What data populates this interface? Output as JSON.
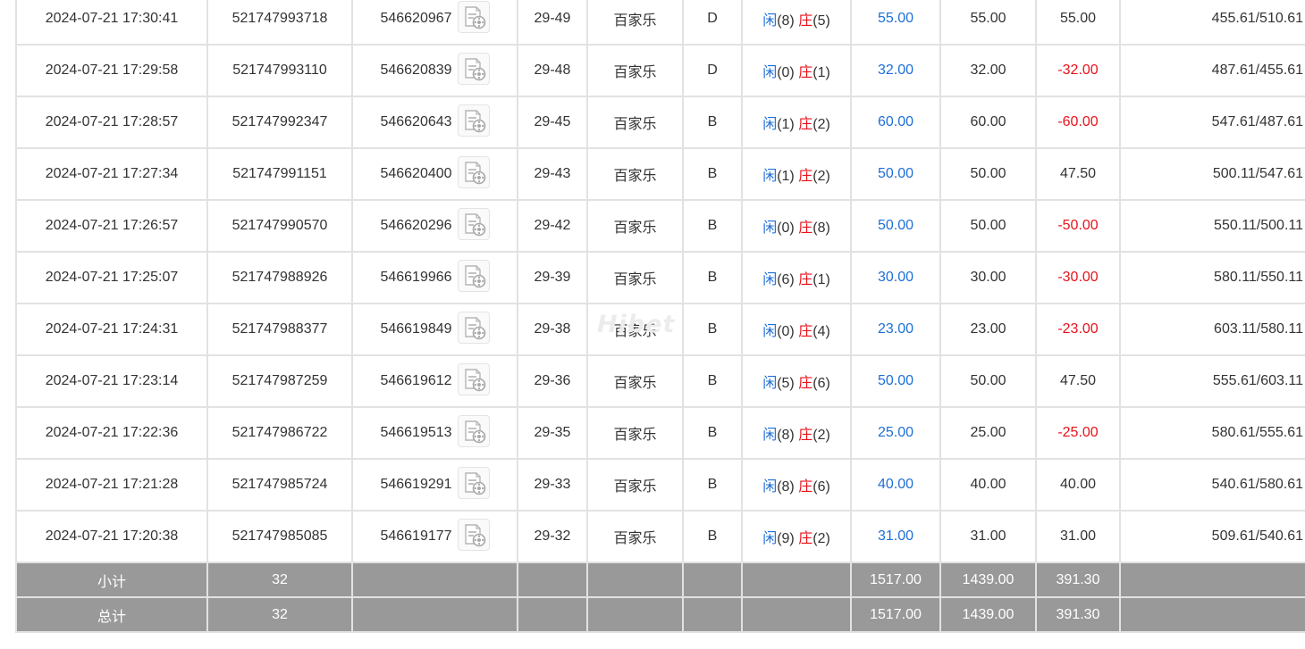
{
  "watermark": "Hibet",
  "colors": {
    "accent_blue": "#1e6fd6",
    "negative_red": "#e8121b",
    "summary_bg": "#999999"
  },
  "rows": [
    {
      "time": "2024-07-21 17:30:41",
      "bet_id": "521747993718",
      "round_id": "546620967",
      "shoe": "29-49",
      "game": "百家乐",
      "result": "D",
      "player_label": "闲",
      "player_score": "(8)",
      "banker_label": "庄",
      "banker_score": "(5)",
      "bet_amount": "55.00",
      "valid_bet": "55.00",
      "win_loss": "55.00",
      "win_loss_negative": false,
      "balance": "455.61/510.61"
    },
    {
      "time": "2024-07-21 17:29:58",
      "bet_id": "521747993110",
      "round_id": "546620839",
      "shoe": "29-48",
      "game": "百家乐",
      "result": "D",
      "player_label": "闲",
      "player_score": "(0)",
      "banker_label": "庄",
      "banker_score": "(1)",
      "bet_amount": "32.00",
      "valid_bet": "32.00",
      "win_loss": "-32.00",
      "win_loss_negative": true,
      "balance": "487.61/455.61"
    },
    {
      "time": "2024-07-21 17:28:57",
      "bet_id": "521747992347",
      "round_id": "546620643",
      "shoe": "29-45",
      "game": "百家乐",
      "result": "B",
      "player_label": "闲",
      "player_score": "(1)",
      "banker_label": "庄",
      "banker_score": "(2)",
      "bet_amount": "60.00",
      "valid_bet": "60.00",
      "win_loss": "-60.00",
      "win_loss_negative": true,
      "balance": "547.61/487.61"
    },
    {
      "time": "2024-07-21 17:27:34",
      "bet_id": "521747991151",
      "round_id": "546620400",
      "shoe": "29-43",
      "game": "百家乐",
      "result": "B",
      "player_label": "闲",
      "player_score": "(1)",
      "banker_label": "庄",
      "banker_score": "(2)",
      "bet_amount": "50.00",
      "valid_bet": "50.00",
      "win_loss": "47.50",
      "win_loss_negative": false,
      "balance": "500.11/547.61"
    },
    {
      "time": "2024-07-21 17:26:57",
      "bet_id": "521747990570",
      "round_id": "546620296",
      "shoe": "29-42",
      "game": "百家乐",
      "result": "B",
      "player_label": "闲",
      "player_score": "(0)",
      "banker_label": "庄",
      "banker_score": "(8)",
      "bet_amount": "50.00",
      "valid_bet": "50.00",
      "win_loss": "-50.00",
      "win_loss_negative": true,
      "balance": "550.11/500.11"
    },
    {
      "time": "2024-07-21 17:25:07",
      "bet_id": "521747988926",
      "round_id": "546619966",
      "shoe": "29-39",
      "game": "百家乐",
      "result": "B",
      "player_label": "闲",
      "player_score": "(6)",
      "banker_label": "庄",
      "banker_score": "(1)",
      "bet_amount": "30.00",
      "valid_bet": "30.00",
      "win_loss": "-30.00",
      "win_loss_negative": true,
      "balance": "580.11/550.11"
    },
    {
      "time": "2024-07-21 17:24:31",
      "bet_id": "521747988377",
      "round_id": "546619849",
      "shoe": "29-38",
      "game": "百家乐",
      "result": "B",
      "player_label": "闲",
      "player_score": "(0)",
      "banker_label": "庄",
      "banker_score": "(4)",
      "bet_amount": "23.00",
      "valid_bet": "23.00",
      "win_loss": "-23.00",
      "win_loss_negative": true,
      "balance": "603.11/580.11"
    },
    {
      "time": "2024-07-21 17:23:14",
      "bet_id": "521747987259",
      "round_id": "546619612",
      "shoe": "29-36",
      "game": "百家乐",
      "result": "B",
      "player_label": "闲",
      "player_score": "(5)",
      "banker_label": "庄",
      "banker_score": "(6)",
      "bet_amount": "50.00",
      "valid_bet": "50.00",
      "win_loss": "47.50",
      "win_loss_negative": false,
      "balance": "555.61/603.11"
    },
    {
      "time": "2024-07-21 17:22:36",
      "bet_id": "521747986722",
      "round_id": "546619513",
      "shoe": "29-35",
      "game": "百家乐",
      "result": "B",
      "player_label": "闲",
      "player_score": "(8)",
      "banker_label": "庄",
      "banker_score": "(2)",
      "bet_amount": "25.00",
      "valid_bet": "25.00",
      "win_loss": "-25.00",
      "win_loss_negative": true,
      "balance": "580.61/555.61"
    },
    {
      "time": "2024-07-21 17:21:28",
      "bet_id": "521747985724",
      "round_id": "546619291",
      "shoe": "29-33",
      "game": "百家乐",
      "result": "B",
      "player_label": "闲",
      "player_score": "(8)",
      "banker_label": "庄",
      "banker_score": "(6)",
      "bet_amount": "40.00",
      "valid_bet": "40.00",
      "win_loss": "40.00",
      "win_loss_negative": false,
      "balance": "540.61/580.61"
    },
    {
      "time": "2024-07-21 17:20:38",
      "bet_id": "521747985085",
      "round_id": "546619177",
      "shoe": "29-32",
      "game": "百家乐",
      "result": "B",
      "player_label": "闲",
      "player_score": "(9)",
      "banker_label": "庄",
      "banker_score": "(2)",
      "bet_amount": "31.00",
      "valid_bet": "31.00",
      "win_loss": "31.00",
      "win_loss_negative": false,
      "balance": "509.61/540.61"
    }
  ],
  "summary": [
    {
      "label": "小计",
      "count": "32",
      "bet_amount": "1517.00",
      "valid_bet": "1439.00",
      "win_loss": "391.30"
    },
    {
      "label": "总计",
      "count": "32",
      "bet_amount": "1517.00",
      "valid_bet": "1439.00",
      "win_loss": "391.30"
    }
  ]
}
